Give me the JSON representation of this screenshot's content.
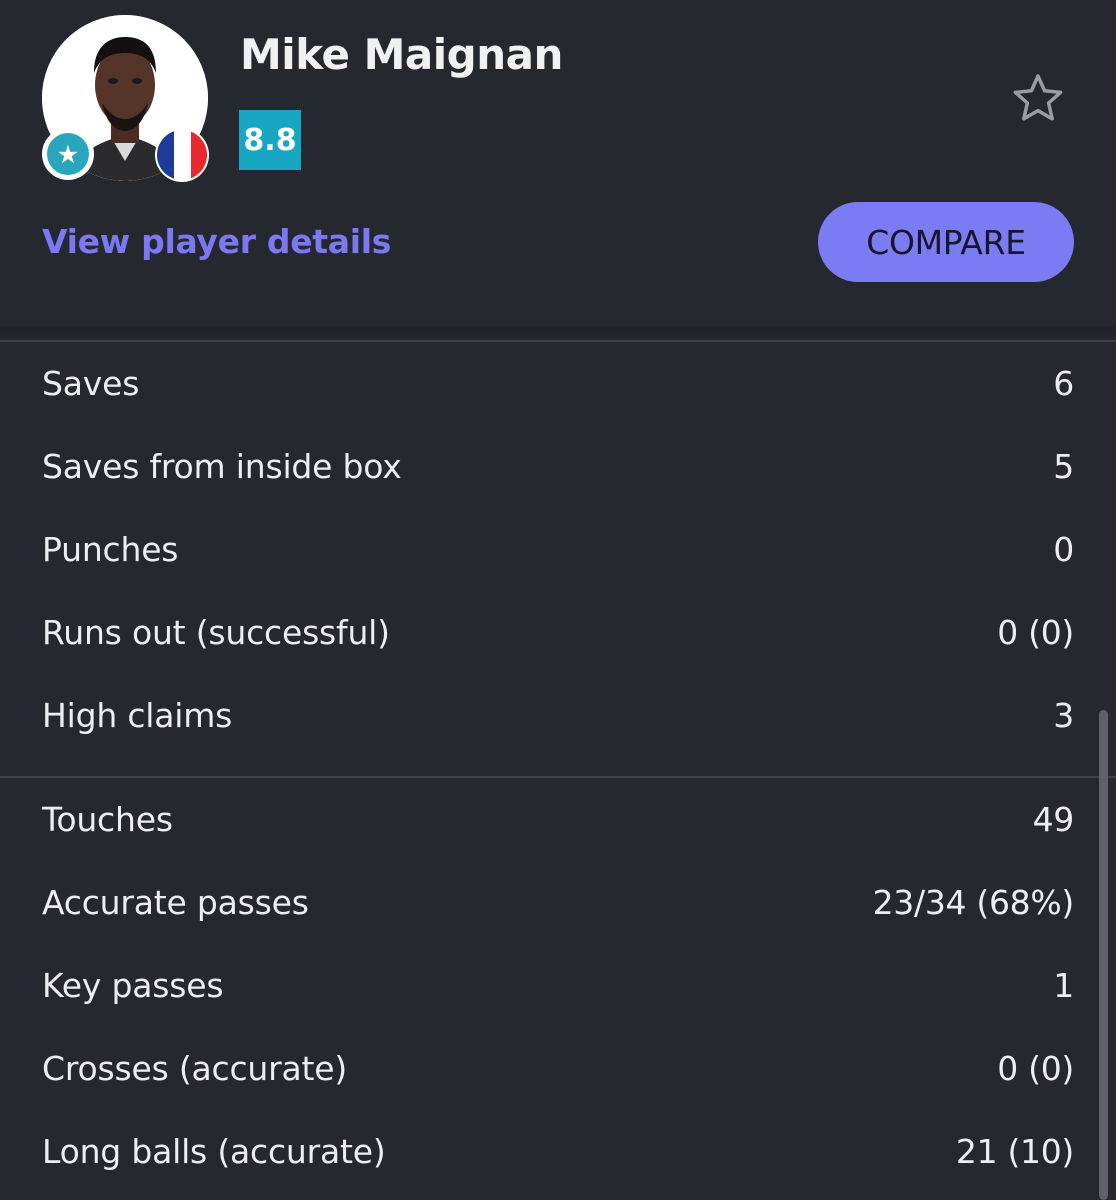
{
  "player": {
    "name": "Mike Maignan",
    "rating": "8.8",
    "avatar": "player-photo",
    "badge_icon": "star-icon",
    "flag": "france-flag"
  },
  "actions": {
    "details_link": "View player details",
    "compare_label": "COMPARE",
    "follow_icon": "star-outline-icon"
  },
  "goalkeeping": [
    {
      "label": "Saves",
      "value": "6"
    },
    {
      "label": "Saves from inside box",
      "value": "5"
    },
    {
      "label": "Punches",
      "value": "0"
    },
    {
      "label": "Runs out (successful)",
      "value": "0 (0)"
    },
    {
      "label": "High claims",
      "value": "3"
    }
  ],
  "distribution": [
    {
      "label": "Touches",
      "value": "49"
    },
    {
      "label": "Accurate passes",
      "value": "23/34 (68%)"
    },
    {
      "label": "Key passes",
      "value": "1"
    },
    {
      "label": "Crosses (accurate)",
      "value": "0 (0)"
    },
    {
      "label": "Long balls (accurate)",
      "value": "21 (10)"
    }
  ],
  "colors": {
    "background": "#262830",
    "accent": "#7b7cf4",
    "rating": "#17a6c3",
    "link": "#7b78f2"
  }
}
